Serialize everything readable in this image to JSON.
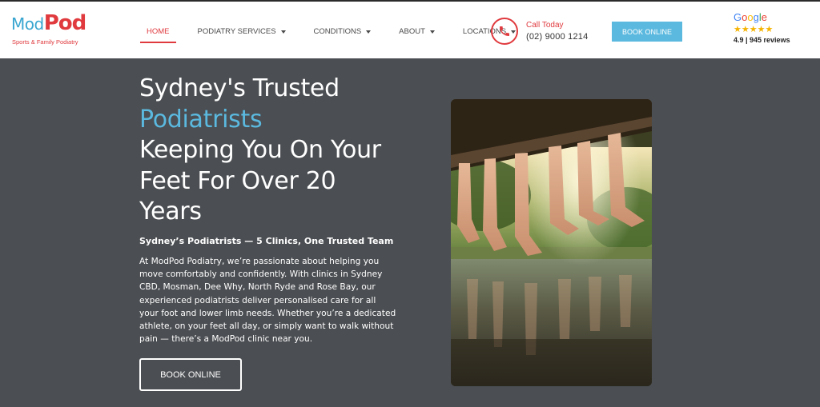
{
  "logo": {
    "mod": "Mod",
    "pod": "Pod",
    "tagline": "Sports & Family Podiatry"
  },
  "nav": {
    "items": [
      {
        "label": "HOME"
      },
      {
        "label": "PODIATRY SERVICES"
      },
      {
        "label": "CONDITIONS"
      },
      {
        "label": "ABOUT"
      },
      {
        "label": "LOCATIONS"
      }
    ]
  },
  "contact": {
    "call_label": "Call Today",
    "phone": "(02) 9000 1214",
    "icon": "phone-icon"
  },
  "header_cta": {
    "label": "BOOK ONLINE"
  },
  "google": {
    "word": [
      "G",
      "o",
      "o",
      "g",
      "l",
      "e"
    ],
    "stars": "★★★★★",
    "reviews": "4.9 | 945 reviews"
  },
  "hero": {
    "title_line1": "Sydney's Trusted",
    "title_accent": "Podiatrists",
    "title_line3": "Keeping You On Your",
    "title_line4": "Feet For Over 20",
    "title_line5": "Years",
    "subhead": "Sydney’s Podiatrists — 5 Clinics, One Trusted Team",
    "body_lines": [
      "At ModPod Podiatry, we’re passionate about helping you",
      "move comfortably and confidently. With clinics in Sydney",
      "CBD, Mosman, Dee Why, North Ryde and Rose Bay, our",
      "experienced podiatrists deliver personalised care for all",
      "your foot and lower limb needs. Whether you’re a dedicated",
      "athlete, on your feet all day, or simply want to walk without",
      "pain — there’s a ModPod clinic near you."
    ],
    "cta": "BOOK ONLINE"
  },
  "colors": {
    "accent_blue": "#5bb9df",
    "accent_red": "#e03a3e",
    "hero_bg": "#4b4e52"
  }
}
